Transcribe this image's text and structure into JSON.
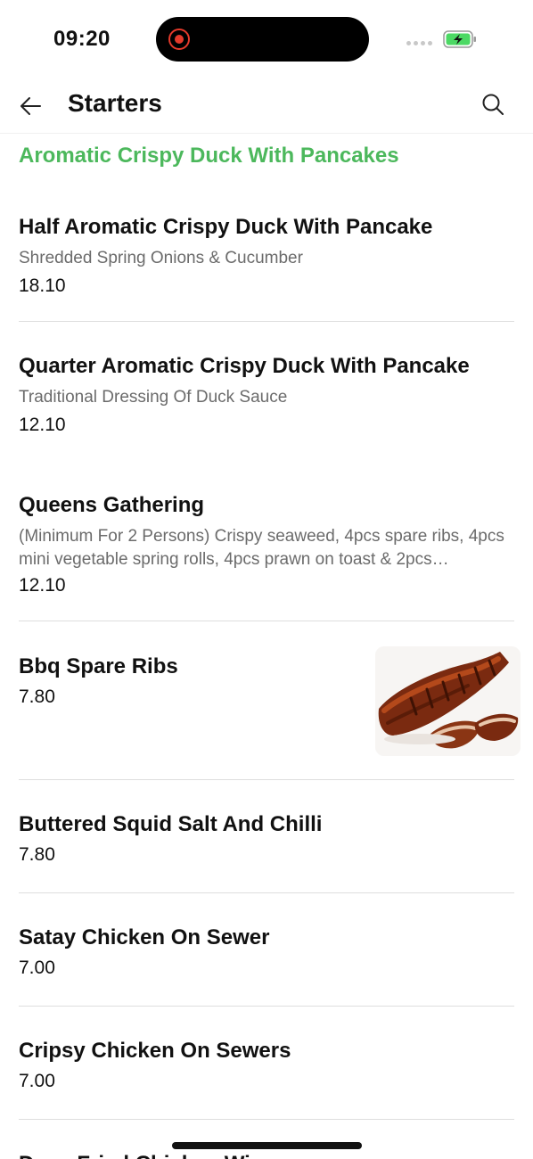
{
  "status_bar": {
    "time": "09:20"
  },
  "header": {
    "title": "Starters",
    "back_icon": "arrow-left-icon",
    "search_icon": "search-icon"
  },
  "category": "Aromatic Crispy Duck With Pancakes",
  "accent_color": "#4cb85c",
  "items": [
    {
      "name": "Half Aromatic Crispy Duck With Pancake",
      "description": "Shredded Spring Onions & Cucumber",
      "price": "18.10"
    },
    {
      "name": "Quarter Aromatic Crispy Duck With Pancake",
      "description": "Traditional Dressing Of Duck Sauce",
      "price": "12.10"
    },
    {
      "name": "Queens Gathering",
      "description": "(Minimum For 2 Persons) Crispy seaweed, 4pcs spare ribs, 4pcs mini vegetable spring rolls, 4pcs prawn on toast & 2pcs…",
      "price": "12.10"
    },
    {
      "name": "Bbq Spare Ribs",
      "price": "7.80",
      "image": "bbq-ribs-photo"
    },
    {
      "name": "Buttered Squid Salt And Chilli",
      "price": "7.80"
    },
    {
      "name": "Satay Chicken On Sewer",
      "price": "7.00"
    },
    {
      "name": "Cripsy Chicken On Sewers",
      "price": "7.00"
    },
    {
      "name": "Deep Fried Chicken Wi"
    }
  ]
}
